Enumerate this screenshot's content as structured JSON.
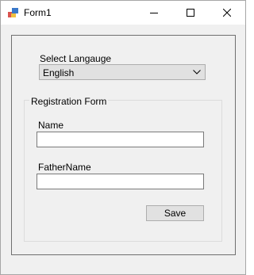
{
  "window": {
    "title": "Form1",
    "icon": "winforms-app-icon",
    "controls": {
      "minimize": "minimize-icon",
      "maximize": "maximize-icon",
      "close": "close-icon"
    }
  },
  "form": {
    "language_label": "Select Langauge",
    "language_selected": "English",
    "group_title": "Registration Form",
    "name_label": "Name",
    "name_value": "",
    "father_label": "FatherName",
    "father_value": "",
    "save_label": "Save"
  }
}
